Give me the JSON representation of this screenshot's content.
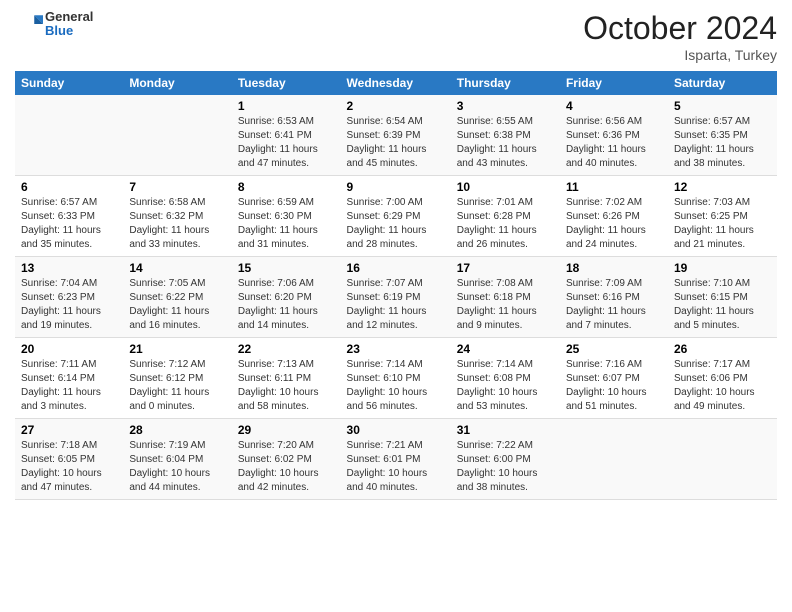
{
  "header": {
    "logo": {
      "general": "General",
      "blue": "Blue"
    },
    "title": "October 2024",
    "location": "Isparta, Turkey"
  },
  "weekdays": [
    "Sunday",
    "Monday",
    "Tuesday",
    "Wednesday",
    "Thursday",
    "Friday",
    "Saturday"
  ],
  "weeks": [
    [
      {
        "day": "",
        "sunrise": "",
        "sunset": "",
        "daylight": ""
      },
      {
        "day": "",
        "sunrise": "",
        "sunset": "",
        "daylight": ""
      },
      {
        "day": "1",
        "sunrise": "Sunrise: 6:53 AM",
        "sunset": "Sunset: 6:41 PM",
        "daylight": "Daylight: 11 hours and 47 minutes."
      },
      {
        "day": "2",
        "sunrise": "Sunrise: 6:54 AM",
        "sunset": "Sunset: 6:39 PM",
        "daylight": "Daylight: 11 hours and 45 minutes."
      },
      {
        "day": "3",
        "sunrise": "Sunrise: 6:55 AM",
        "sunset": "Sunset: 6:38 PM",
        "daylight": "Daylight: 11 hours and 43 minutes."
      },
      {
        "day": "4",
        "sunrise": "Sunrise: 6:56 AM",
        "sunset": "Sunset: 6:36 PM",
        "daylight": "Daylight: 11 hours and 40 minutes."
      },
      {
        "day": "5",
        "sunrise": "Sunrise: 6:57 AM",
        "sunset": "Sunset: 6:35 PM",
        "daylight": "Daylight: 11 hours and 38 minutes."
      }
    ],
    [
      {
        "day": "6",
        "sunrise": "Sunrise: 6:57 AM",
        "sunset": "Sunset: 6:33 PM",
        "daylight": "Daylight: 11 hours and 35 minutes."
      },
      {
        "day": "7",
        "sunrise": "Sunrise: 6:58 AM",
        "sunset": "Sunset: 6:32 PM",
        "daylight": "Daylight: 11 hours and 33 minutes."
      },
      {
        "day": "8",
        "sunrise": "Sunrise: 6:59 AM",
        "sunset": "Sunset: 6:30 PM",
        "daylight": "Daylight: 11 hours and 31 minutes."
      },
      {
        "day": "9",
        "sunrise": "Sunrise: 7:00 AM",
        "sunset": "Sunset: 6:29 PM",
        "daylight": "Daylight: 11 hours and 28 minutes."
      },
      {
        "day": "10",
        "sunrise": "Sunrise: 7:01 AM",
        "sunset": "Sunset: 6:28 PM",
        "daylight": "Daylight: 11 hours and 26 minutes."
      },
      {
        "day": "11",
        "sunrise": "Sunrise: 7:02 AM",
        "sunset": "Sunset: 6:26 PM",
        "daylight": "Daylight: 11 hours and 24 minutes."
      },
      {
        "day": "12",
        "sunrise": "Sunrise: 7:03 AM",
        "sunset": "Sunset: 6:25 PM",
        "daylight": "Daylight: 11 hours and 21 minutes."
      }
    ],
    [
      {
        "day": "13",
        "sunrise": "Sunrise: 7:04 AM",
        "sunset": "Sunset: 6:23 PM",
        "daylight": "Daylight: 11 hours and 19 minutes."
      },
      {
        "day": "14",
        "sunrise": "Sunrise: 7:05 AM",
        "sunset": "Sunset: 6:22 PM",
        "daylight": "Daylight: 11 hours and 16 minutes."
      },
      {
        "day": "15",
        "sunrise": "Sunrise: 7:06 AM",
        "sunset": "Sunset: 6:20 PM",
        "daylight": "Daylight: 11 hours and 14 minutes."
      },
      {
        "day": "16",
        "sunrise": "Sunrise: 7:07 AM",
        "sunset": "Sunset: 6:19 PM",
        "daylight": "Daylight: 11 hours and 12 minutes."
      },
      {
        "day": "17",
        "sunrise": "Sunrise: 7:08 AM",
        "sunset": "Sunset: 6:18 PM",
        "daylight": "Daylight: 11 hours and 9 minutes."
      },
      {
        "day": "18",
        "sunrise": "Sunrise: 7:09 AM",
        "sunset": "Sunset: 6:16 PM",
        "daylight": "Daylight: 11 hours and 7 minutes."
      },
      {
        "day": "19",
        "sunrise": "Sunrise: 7:10 AM",
        "sunset": "Sunset: 6:15 PM",
        "daylight": "Daylight: 11 hours and 5 minutes."
      }
    ],
    [
      {
        "day": "20",
        "sunrise": "Sunrise: 7:11 AM",
        "sunset": "Sunset: 6:14 PM",
        "daylight": "Daylight: 11 hours and 3 minutes."
      },
      {
        "day": "21",
        "sunrise": "Sunrise: 7:12 AM",
        "sunset": "Sunset: 6:12 PM",
        "daylight": "Daylight: 11 hours and 0 minutes."
      },
      {
        "day": "22",
        "sunrise": "Sunrise: 7:13 AM",
        "sunset": "Sunset: 6:11 PM",
        "daylight": "Daylight: 10 hours and 58 minutes."
      },
      {
        "day": "23",
        "sunrise": "Sunrise: 7:14 AM",
        "sunset": "Sunset: 6:10 PM",
        "daylight": "Daylight: 10 hours and 56 minutes."
      },
      {
        "day": "24",
        "sunrise": "Sunrise: 7:14 AM",
        "sunset": "Sunset: 6:08 PM",
        "daylight": "Daylight: 10 hours and 53 minutes."
      },
      {
        "day": "25",
        "sunrise": "Sunrise: 7:16 AM",
        "sunset": "Sunset: 6:07 PM",
        "daylight": "Daylight: 10 hours and 51 minutes."
      },
      {
        "day": "26",
        "sunrise": "Sunrise: 7:17 AM",
        "sunset": "Sunset: 6:06 PM",
        "daylight": "Daylight: 10 hours and 49 minutes."
      }
    ],
    [
      {
        "day": "27",
        "sunrise": "Sunrise: 7:18 AM",
        "sunset": "Sunset: 6:05 PM",
        "daylight": "Daylight: 10 hours and 47 minutes."
      },
      {
        "day": "28",
        "sunrise": "Sunrise: 7:19 AM",
        "sunset": "Sunset: 6:04 PM",
        "daylight": "Daylight: 10 hours and 44 minutes."
      },
      {
        "day": "29",
        "sunrise": "Sunrise: 7:20 AM",
        "sunset": "Sunset: 6:02 PM",
        "daylight": "Daylight: 10 hours and 42 minutes."
      },
      {
        "day": "30",
        "sunrise": "Sunrise: 7:21 AM",
        "sunset": "Sunset: 6:01 PM",
        "daylight": "Daylight: 10 hours and 40 minutes."
      },
      {
        "day": "31",
        "sunrise": "Sunrise: 7:22 AM",
        "sunset": "Sunset: 6:00 PM",
        "daylight": "Daylight: 10 hours and 38 minutes."
      },
      {
        "day": "",
        "sunrise": "",
        "sunset": "",
        "daylight": ""
      },
      {
        "day": "",
        "sunrise": "",
        "sunset": "",
        "daylight": ""
      }
    ]
  ]
}
